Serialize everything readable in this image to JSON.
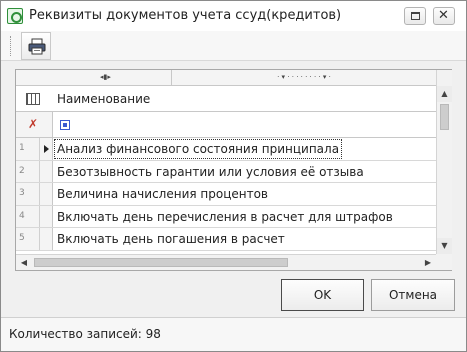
{
  "window": {
    "title": "Реквизиты документов учета ссуд(кредитов)"
  },
  "title_buttons": {
    "maximize_icon": "maximize-icon",
    "close_icon": "close-icon",
    "close_glyph": "✕"
  },
  "toolbar": {
    "print_icon": "printer-icon"
  },
  "grid": {
    "band_left_glyph": "◂▮▸",
    "band_right_glyph": "· ▾ · · · · · · · · ▾ ·",
    "column_header": "Наименование",
    "rows": [
      {
        "num": "1",
        "text": "Анализ финансового состояния принципала",
        "selected": true
      },
      {
        "num": "2",
        "text": "Безотзывность гарантии или условия её отзыва",
        "selected": false
      },
      {
        "num": "3",
        "text": "Величина начисления процентов",
        "selected": false
      },
      {
        "num": "4",
        "text": "Включать день перечисления в расчет для штрафов",
        "selected": false
      },
      {
        "num": "5",
        "text": "Включать день погашения в расчет",
        "selected": false
      }
    ],
    "scroll_up": "▲",
    "scroll_down": "▼",
    "scroll_left": "◀",
    "scroll_right": "▶"
  },
  "buttons": {
    "ok": "OK",
    "cancel": "Отмена"
  },
  "status": {
    "text": "Количество записей: 98"
  }
}
